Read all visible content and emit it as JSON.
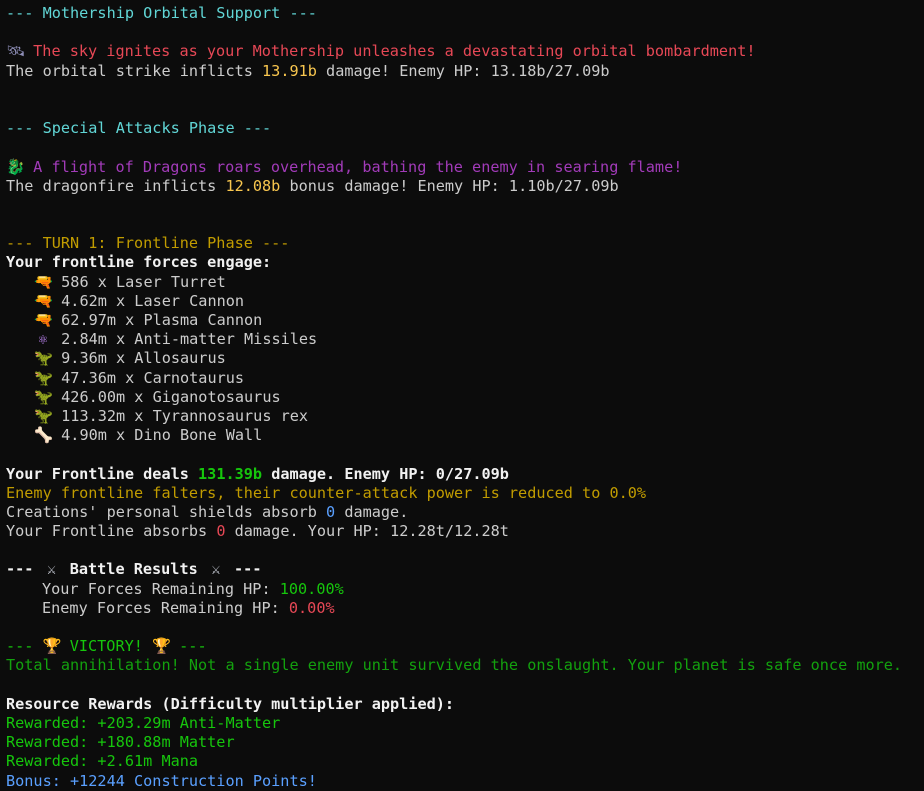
{
  "orbital": {
    "header": "--- Mothership Orbital Support ---",
    "icon": "satellite-icon",
    "flavor": "The sky ignites as your Mothership unleashes a devastating orbital bombardment!",
    "dmg_prefix": "The orbital strike inflicts ",
    "dmg_value": "13.91b",
    "dmg_suffix": " damage! Enemy HP: 13.18b/27.09b"
  },
  "special": {
    "header": "--- Special Attacks Phase ---",
    "icon": "dragon-icon",
    "flavor": "A flight of Dragons roars overhead, bathing the enemy in searing flame!",
    "dmg_prefix": "The dragonfire inflicts ",
    "dmg_value": "12.08b",
    "dmg_suffix": " bonus damage! Enemy HP: 1.10b/27.09b"
  },
  "frontline": {
    "header": "--- TURN 1: Frontline Phase ---",
    "intro": "Your frontline forces engage:",
    "units": [
      {
        "icon": "laser-gun-icon",
        "text": "586 x Laser Turret"
      },
      {
        "icon": "laser-gun-icon",
        "text": "4.62m x Laser Cannon"
      },
      {
        "icon": "laser-gun-icon",
        "text": "62.97m x Plasma Cannon"
      },
      {
        "icon": "atom-icon",
        "text": "2.84m x Anti-matter Missiles"
      },
      {
        "icon": "dinosaur-icon",
        "text": "9.36m x Allosaurus"
      },
      {
        "icon": "dinosaur-icon",
        "text": "47.36m x Carnotaurus"
      },
      {
        "icon": "dinosaur-icon",
        "text": "426.00m x Giganotosaurus"
      },
      {
        "icon": "dinosaur-icon",
        "text": "113.32m x Tyrannosaurus rex"
      },
      {
        "icon": "bone-icon",
        "text": "4.90m x Dino Bone Wall"
      }
    ],
    "deals_prefix": "Your Frontline deals ",
    "deals_value": "131.39b",
    "deals_suffix": " damage. Enemy HP: 0/27.09b",
    "falter": "Enemy frontline falters, their counter-attack power is reduced to 0.0%",
    "shield_prefix": "Creations' personal shields absorb ",
    "shield_value": "0",
    "shield_suffix": " damage.",
    "absorb_prefix": "Your Frontline absorbs ",
    "absorb_value": "0",
    "absorb_suffix": " damage. Your HP: 12.28t/12.28t"
  },
  "results": {
    "header_prefix": "--- ",
    "header_title": " Battle Results ",
    "header_suffix": " ---",
    "icon": "crossed-swords-icon",
    "your_label": "Your Forces Remaining HP: ",
    "your_value": "100.00%",
    "enemy_label": "Enemy Forces Remaining HP: ",
    "enemy_value": "0.00%"
  },
  "victory": {
    "header_prefix": "--- ",
    "header_title": " VICTORY! ",
    "header_suffix": " ---",
    "icon": "trophy-icon",
    "message": "Total annihilation! Not a single enemy unit survived the onslaught. Your planet is safe once more."
  },
  "rewards": {
    "header": "Resource Rewards (Difficulty multiplier applied):",
    "items": [
      "Rewarded: +203.29m Anti-Matter",
      "Rewarded: +180.88m Matter",
      "Rewarded: +2.61m Mana"
    ],
    "bonus": "Bonus: +12244 Construction Points!"
  }
}
